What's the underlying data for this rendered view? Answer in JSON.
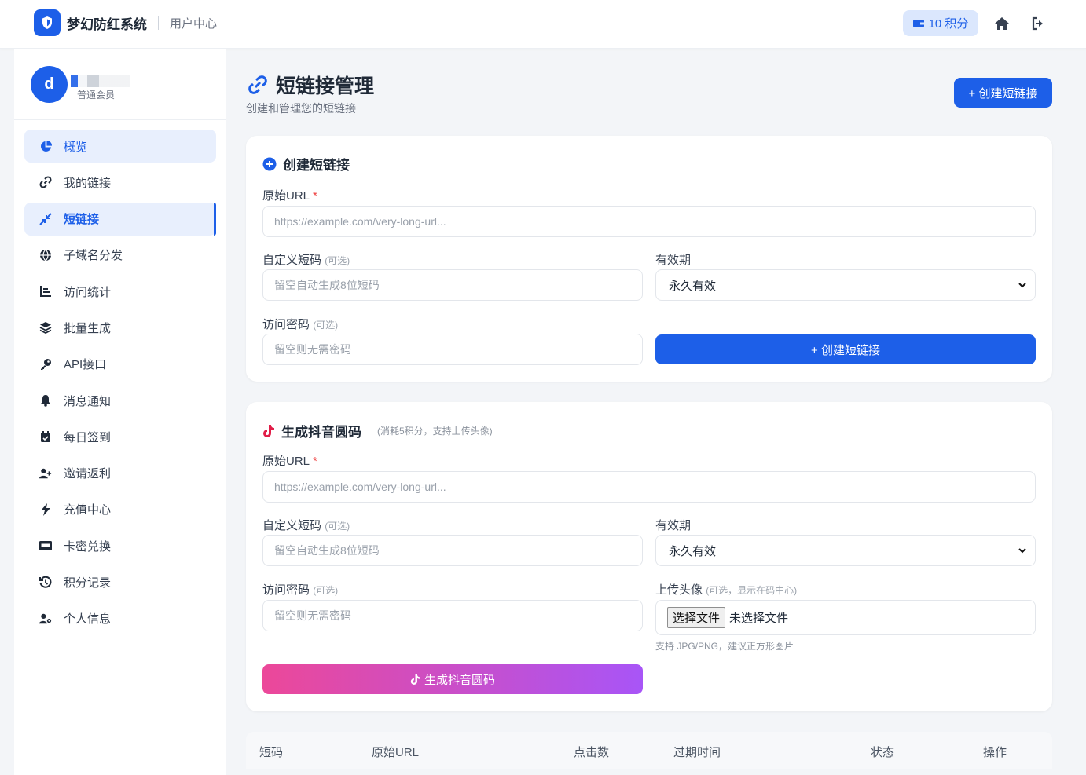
{
  "header": {
    "brand_name": "梦幻防红系统",
    "brand_sub": "用户中心",
    "points_label": "10 积分"
  },
  "user": {
    "avatar_letter": "d",
    "role": "普通会员"
  },
  "sidebar": {
    "items": [
      {
        "label": "概览",
        "icon": "pie-chart-icon"
      },
      {
        "label": "我的链接",
        "icon": "link-icon"
      },
      {
        "label": "短链接",
        "icon": "compress-icon"
      },
      {
        "label": "子域名分发",
        "icon": "globe-icon"
      },
      {
        "label": "访问统计",
        "icon": "bar-chart-icon"
      },
      {
        "label": "批量生成",
        "icon": "layers-icon"
      },
      {
        "label": "API接口",
        "icon": "key-icon"
      },
      {
        "label": "消息通知",
        "icon": "bell-icon"
      },
      {
        "label": "每日签到",
        "icon": "calendar-check-icon"
      },
      {
        "label": "邀请返利",
        "icon": "user-plus-icon"
      },
      {
        "label": "充值中心",
        "icon": "bolt-icon"
      },
      {
        "label": "卡密兑换",
        "icon": "card-icon"
      },
      {
        "label": "积分记录",
        "icon": "history-icon"
      },
      {
        "label": "个人信息",
        "icon": "user-gear-icon"
      }
    ]
  },
  "page": {
    "title": "短链接管理",
    "subtitle": "创建和管理您的短链接",
    "create_button": "+ 创建短链接"
  },
  "create_form": {
    "title": "创建短链接",
    "url_label": "原始URL",
    "url_required": "*",
    "url_placeholder": "https://example.com/very-long-url...",
    "code_label": "自定义短码",
    "optional": "(可选)",
    "code_placeholder": "留空自动生成8位短码",
    "expiry_label": "有效期",
    "expiry_value": "永久有效",
    "password_label": "访问密码",
    "password_placeholder": "留空则无需密码",
    "submit": "+ 创建短链接"
  },
  "douyin_form": {
    "title": "生成抖音圆码",
    "hint": "(消耗5积分，支持上传头像)",
    "url_label": "原始URL",
    "url_required": "*",
    "url_placeholder": "https://example.com/very-long-url...",
    "code_label": "自定义短码",
    "optional": "(可选)",
    "code_placeholder": "留空自动生成8位短码",
    "expiry_label": "有效期",
    "expiry_value": "永久有效",
    "password_label": "访问密码",
    "password_placeholder": "留空则无需密码",
    "avatar_label": "上传头像",
    "avatar_hint": "(可选，显示在码中心)",
    "file_button": "选择文件",
    "file_status": "未选择文件",
    "file_help": "支持 JPG/PNG，建议正方形图片",
    "submit": "生成抖音圆码"
  },
  "table": {
    "headers": [
      "短码",
      "原始URL",
      "点击数",
      "过期时间",
      "状态",
      "操作"
    ]
  },
  "colors": {
    "primary": "#1d5fe8",
    "douyin_gradient_start": "#ec4899",
    "douyin_gradient_end": "#a855f7"
  }
}
